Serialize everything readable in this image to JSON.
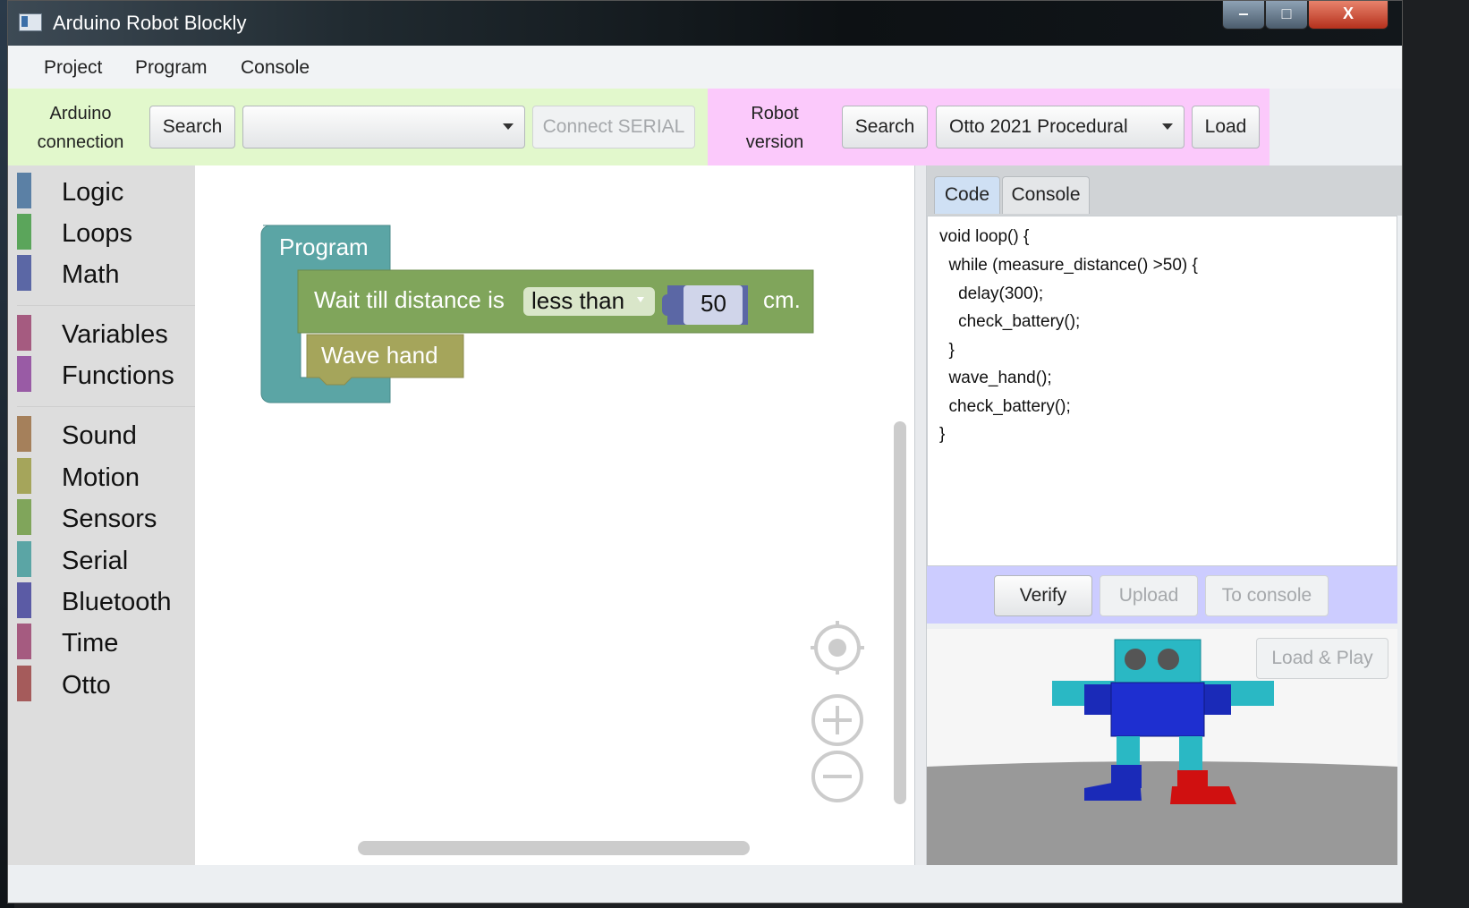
{
  "window": {
    "title": "Arduino Robot Blockly",
    "controls": {
      "minimize": "‒",
      "maximize": "□",
      "close": "X"
    }
  },
  "menu": {
    "items": [
      "Project",
      "Program",
      "Console"
    ]
  },
  "toolbar": {
    "arduino_label_line1": "Arduino",
    "arduino_label_line2": "connection",
    "arduino_search": "Search",
    "port_value": "",
    "connect_serial": "Connect SERIAL",
    "robot_label_line1": "Robot",
    "robot_label_line2": "version",
    "robot_search": "Search",
    "robot_version_value": "Otto 2021 Procedural",
    "load": "Load",
    "colors": {
      "arduino_bg": "#e2f8cc",
      "robot_bg": "#fbc9fb"
    }
  },
  "toolbox": {
    "categories": [
      {
        "label": "Logic",
        "color": "#5b80a5"
      },
      {
        "label": "Loops",
        "color": "#5ba55b"
      },
      {
        "label": "Math",
        "color": "#5b67a5"
      },
      {
        "label": "Variables",
        "color": "#a55b80"
      },
      {
        "label": "Functions",
        "color": "#995ba5"
      },
      {
        "label": "Sound",
        "color": "#a5805b"
      },
      {
        "label": "Motion",
        "color": "#a5a55b"
      },
      {
        "label": "Sensors",
        "color": "#80a55b"
      },
      {
        "label": "Serial",
        "color": "#5ba5a5"
      },
      {
        "label": "Bluetooth",
        "color": "#5b5ba5"
      },
      {
        "label": "Time",
        "color": "#a55b80"
      },
      {
        "label": "Otto",
        "color": "#a55b5b"
      }
    ]
  },
  "workspace": {
    "program_block": "Program",
    "wait_block": {
      "prefix": "Wait till distance is",
      "dropdown": "less than",
      "value": "50",
      "suffix": "cm."
    },
    "wave_block": "Wave hand",
    "colors": {
      "program": "#5ba5a5",
      "wait": "#80a55b",
      "wave": "#a5a55b"
    }
  },
  "right_panel": {
    "tabs": [
      "Code",
      "Console"
    ],
    "active_tab": "Code",
    "code_lines": [
      "void loop() {",
      "  while (measure_distance() >50) {",
      "    delay(300);",
      "    check_battery();",
      "  }",
      "  wave_hand();",
      "  check_battery();",
      "}"
    ],
    "verify": "Verify",
    "upload": "Upload",
    "to_console": "To console",
    "load_play": "Load & Play"
  }
}
